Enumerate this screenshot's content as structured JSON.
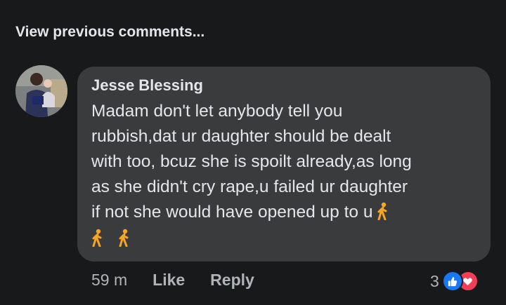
{
  "view_previous": "View previous comments...",
  "comment": {
    "author": "Jesse Blessing",
    "lines": [
      "Madam don't let anybody tell you",
      "rubbish,dat ur daughter should be dealt",
      "with too, bcuz she is spoilt already,as long",
      "as she didn't cry rape,u failed ur daughter",
      "if not she would have opened up to u"
    ],
    "emojis": [
      "person-walking-icon",
      "person-walking-icon",
      "person-walking-icon"
    ],
    "time": "59 m",
    "like_label": "Like",
    "reply_label": "Reply",
    "reaction_count": "3",
    "reactions": [
      "like-icon",
      "love-icon"
    ]
  },
  "colors": {
    "background": "#18191a",
    "bubble": "#3a3b3c",
    "text": "#e4e6eb",
    "secondary_text": "#b0b3b8",
    "like_blue": "#1877f2",
    "love_red": "#f33e58",
    "emoji_orange": "#f5a623"
  }
}
